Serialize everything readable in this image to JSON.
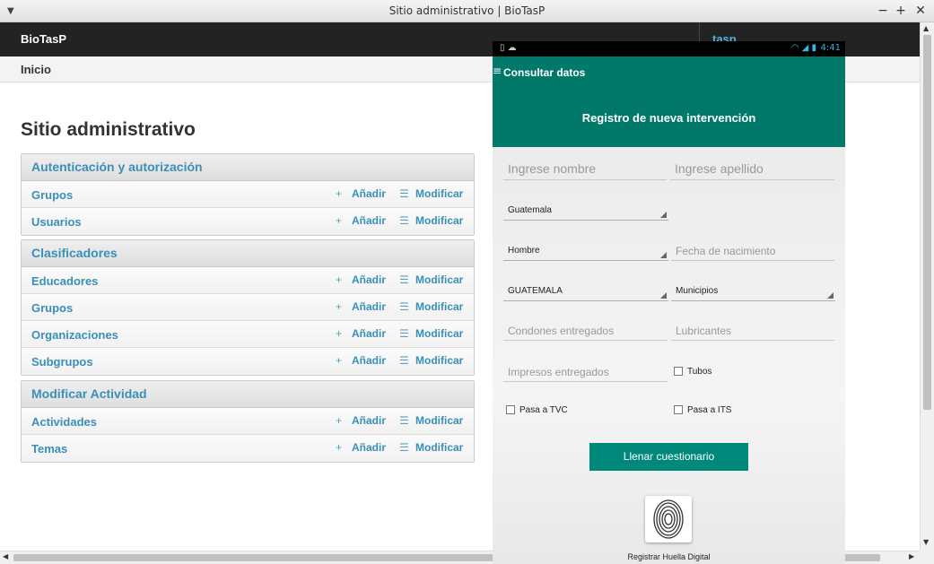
{
  "window": {
    "title": "Sitio administrativo | BioTasP"
  },
  "header": {
    "brand": "BioTasP",
    "user_link": "tasp"
  },
  "breadcrumbs": {
    "home": "Inicio"
  },
  "page": {
    "title": "Sitio administrativo"
  },
  "actions": {
    "add": "Añadir",
    "change": "Modificar"
  },
  "modules": [
    {
      "title": "Autenticación y autorización",
      "rows": [
        "Grupos",
        "Usuarios"
      ]
    },
    {
      "title": "Clasificadores",
      "rows": [
        "Educadores",
        "Grupos",
        "Organizaciones",
        "Subgrupos"
      ]
    },
    {
      "title": "Modificar Actividad",
      "rows": [
        "Actividades",
        "Temas"
      ]
    }
  ],
  "phone": {
    "status": {
      "time": "4:41"
    },
    "action_bar": {
      "title": "Consultar datos"
    },
    "hero": {
      "title": "Registro de nueva intervención"
    },
    "form": {
      "nombre_placeholder": "Ingrese nombre",
      "apellido_placeholder": "Ingrese apellido",
      "pais_value": "Guatemala",
      "sexo_value": "Hombre",
      "fecha_placeholder": "Fecha de nacimiento",
      "departamento_value": "GUATEMALA",
      "municipio_value": "Municipios",
      "condones_placeholder": "Condones entregados",
      "lubricantes_placeholder": "Lubricantes",
      "impresos_placeholder": "Impresos entregados",
      "tubos_label": "Tubos",
      "tvc_label": "Pasa a TVC",
      "its_label": "Pasa a ITS",
      "llenar_button": "Llenar cuestionario",
      "huella_label": "Registrar Huella Digital"
    }
  },
  "colors": {
    "accent": "#00796b",
    "link": "#3a8fb7",
    "header_bg": "#232323"
  }
}
